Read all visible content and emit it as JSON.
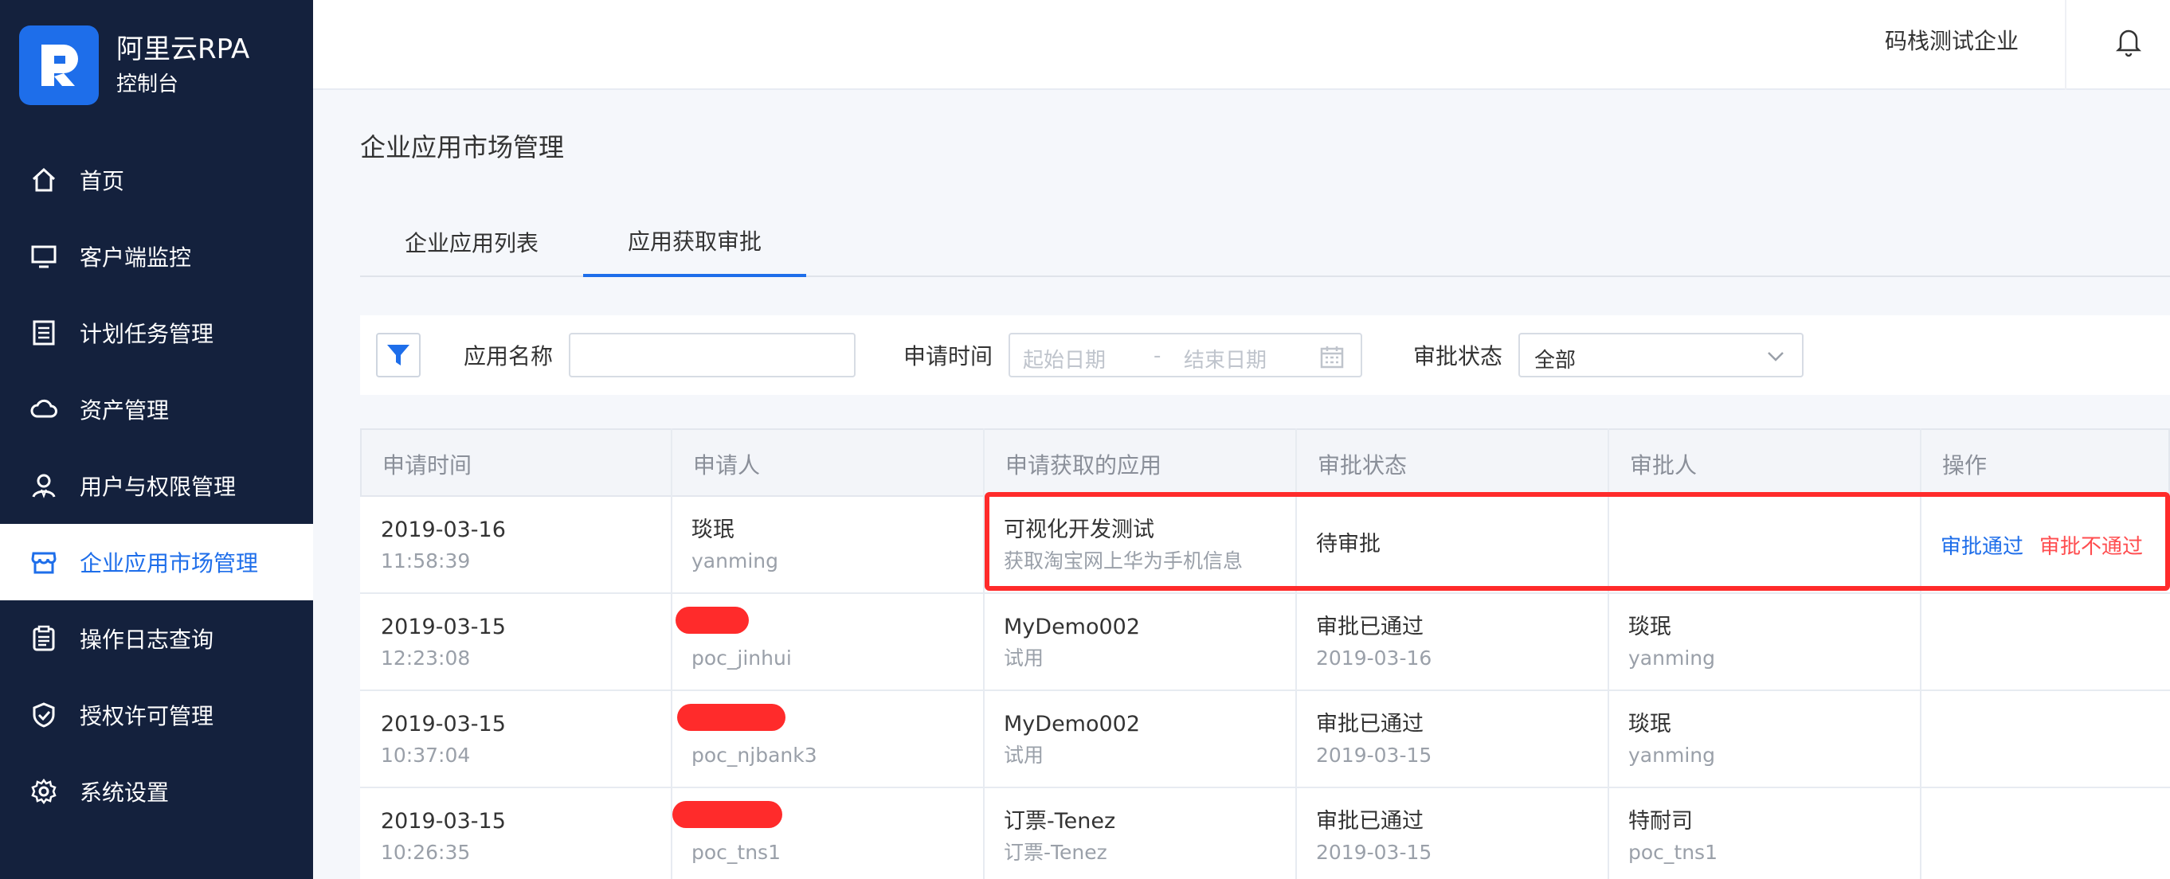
{
  "app": {
    "name": "阿里云RPA",
    "sub": "控制台"
  },
  "sidebar": {
    "items": [
      {
        "label": "首页",
        "icon": "home-icon"
      },
      {
        "label": "客户端监控",
        "icon": "monitor-icon"
      },
      {
        "label": "计划任务管理",
        "icon": "list-icon"
      },
      {
        "label": "资产管理",
        "icon": "cloud-icon"
      },
      {
        "label": "用户与权限管理",
        "icon": "user-icon"
      },
      {
        "label": "企业应用市场管理",
        "icon": "store-icon",
        "active": true
      },
      {
        "label": "操作日志查询",
        "icon": "log-icon"
      },
      {
        "label": "授权许可管理",
        "icon": "shield-icon"
      },
      {
        "label": "系统设置",
        "icon": "gear-icon"
      }
    ]
  },
  "header": {
    "org": "码栈测试企业",
    "bell_icon": "bell-icon"
  },
  "page": {
    "title": "企业应用市场管理",
    "tabs": [
      {
        "label": "企业应用列表"
      },
      {
        "label": "应用获取审批",
        "active": true
      }
    ]
  },
  "filters": {
    "app_name_label": "应用名称",
    "app_name_value": "",
    "time_label": "申请时间",
    "start_placeholder": "起始日期",
    "range_sep": "-",
    "end_placeholder": "结束日期",
    "status_label": "审批状态",
    "status_value": "全部"
  },
  "table": {
    "headers": [
      "申请时间",
      "申请人",
      "申请获取的应用",
      "审批状态",
      "审批人",
      "操作"
    ],
    "rows": [
      {
        "date": "2019-03-16",
        "time": "11:58:39",
        "applicant": "琰珉",
        "applicant_id": "yanming",
        "app": "可视化开发测试",
        "app_desc": "获取淘宝网上华为手机信息",
        "status": "待审批",
        "status_date": "",
        "approver": "",
        "approver_id": "",
        "action_approve": "审批通过",
        "action_reject": "审批不通过"
      },
      {
        "date": "2019-03-15",
        "time": "12:23:08",
        "applicant": "",
        "applicant_id": "poc_jinhui",
        "app": "MyDemo002",
        "app_desc": "试用",
        "status": "审批已通过",
        "status_date": "2019-03-16",
        "approver": "琰珉",
        "approver_id": "yanming"
      },
      {
        "date": "2019-03-15",
        "time": "10:37:04",
        "applicant": "",
        "applicant_id": "poc_njbank3",
        "app": "MyDemo002",
        "app_desc": "试用",
        "status": "审批已通过",
        "status_date": "2019-03-15",
        "approver": "琰珉",
        "approver_id": "yanming"
      },
      {
        "date": "2019-03-15",
        "time": "10:26:35",
        "applicant": "",
        "applicant_id": "poc_tns1",
        "app": "订票-Tenez",
        "app_desc": "订票-Tenez",
        "status": "审批已通过",
        "status_date": "2019-03-15",
        "approver": "特耐司",
        "approver_id": "poc_tns1"
      }
    ]
  },
  "colors": {
    "sidebar": "#14213d",
    "accent": "#1e6eea",
    "danger": "#ff4d4f",
    "highlight": "#ff2b2b"
  }
}
